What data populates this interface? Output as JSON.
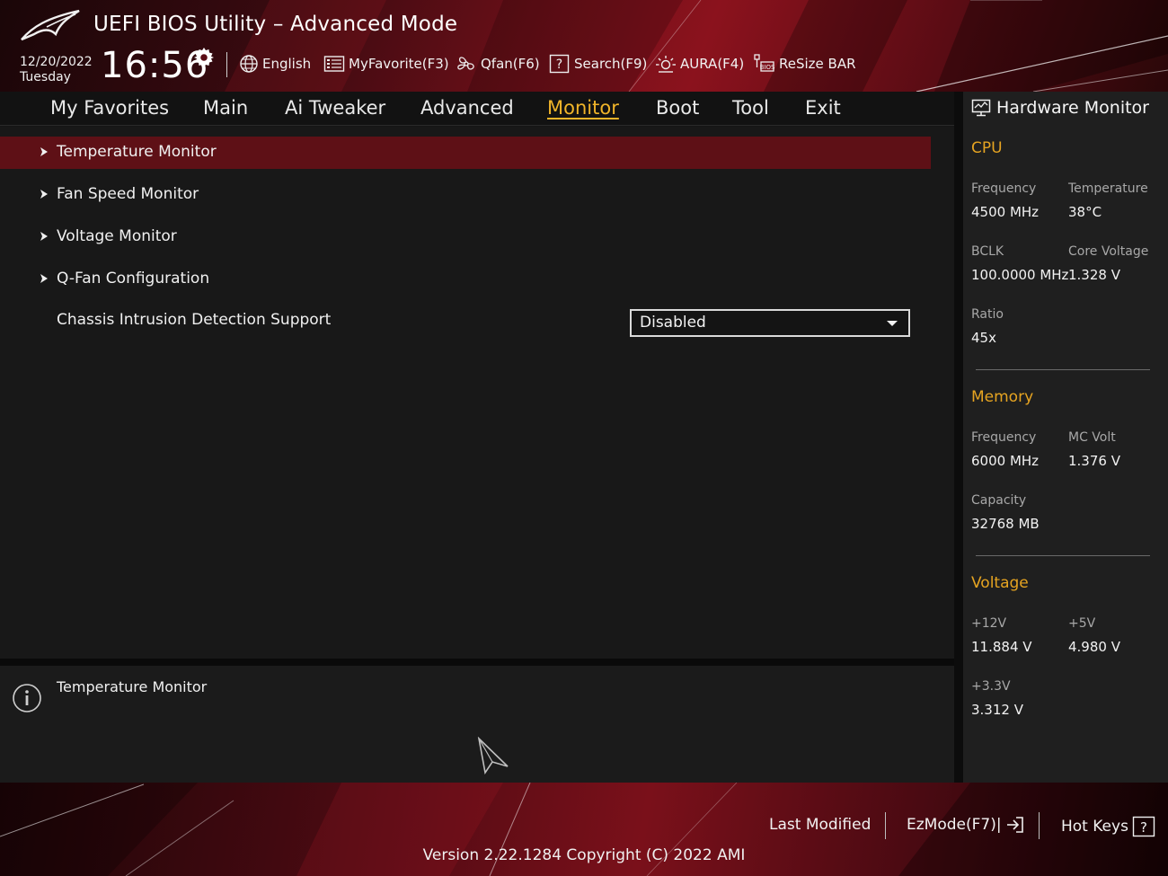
{
  "header": {
    "title": "UEFI BIOS Utility – Advanced Mode",
    "date": "12/20/2022",
    "day": "Tuesday",
    "time": "16:56",
    "toolbar": [
      {
        "label": "English",
        "icon": "globe-icon"
      },
      {
        "label": "MyFavorite(F3)",
        "icon": "favorite-list-icon"
      },
      {
        "label": "Qfan(F6)",
        "icon": "fan-icon"
      },
      {
        "label": "Search(F9)",
        "icon": "search-help-icon"
      },
      {
        "label": "AURA(F4)",
        "icon": "aura-light-icon"
      },
      {
        "label": "ReSize BAR",
        "icon": "resize-bar-icon"
      }
    ]
  },
  "nav": {
    "tabs": [
      {
        "label": "My Favorites"
      },
      {
        "label": "Main"
      },
      {
        "label": "Ai Tweaker"
      },
      {
        "label": "Advanced"
      },
      {
        "label": "Monitor",
        "active": true
      },
      {
        "label": "Boot"
      },
      {
        "label": "Tool"
      },
      {
        "label": "Exit"
      }
    ]
  },
  "main": {
    "items": [
      {
        "label": "Temperature Monitor",
        "submenu": true,
        "selected": true
      },
      {
        "label": "Fan Speed Monitor",
        "submenu": true
      },
      {
        "label": "Voltage Monitor",
        "submenu": true
      },
      {
        "label": "Q-Fan Configuration",
        "submenu": true
      },
      {
        "label": "Chassis Intrusion Detection Support",
        "submenu": false,
        "value": "Disabled"
      }
    ]
  },
  "help": {
    "text": "Temperature Monitor"
  },
  "hardware_monitor": {
    "title": "Hardware Monitor",
    "cpu": {
      "heading": "CPU",
      "frequency_label": "Frequency",
      "frequency": "4500 MHz",
      "temperature_label": "Temperature",
      "temperature": "38°C",
      "bclk_label": "BCLK",
      "bclk": "100.0000 MHz",
      "core_voltage_label": "Core Voltage",
      "core_voltage": "1.328 V",
      "ratio_label": "Ratio",
      "ratio": "45x"
    },
    "memory": {
      "heading": "Memory",
      "frequency_label": "Frequency",
      "frequency": "6000 MHz",
      "mc_volt_label": "MC Volt",
      "mc_volt": "1.376 V",
      "capacity_label": "Capacity",
      "capacity": "32768 MB"
    },
    "voltage": {
      "heading": "Voltage",
      "v12_label": "+12V",
      "v12": "11.884 V",
      "v5_label": "+5V",
      "v5": "4.980 V",
      "v33_label": "+3.3V",
      "v33": "3.312 V"
    }
  },
  "footer": {
    "last_modified": "Last Modified",
    "ezmode": "EzMode(F7)|",
    "hotkeys": "Hot Keys",
    "version": "Version 2.22.1284 Copyright (C) 2022 AMI"
  },
  "colors": {
    "accent": "#f0b429",
    "section": "#e6a421",
    "selected_row": "#5e1016",
    "brand_red": "#8b121d"
  }
}
